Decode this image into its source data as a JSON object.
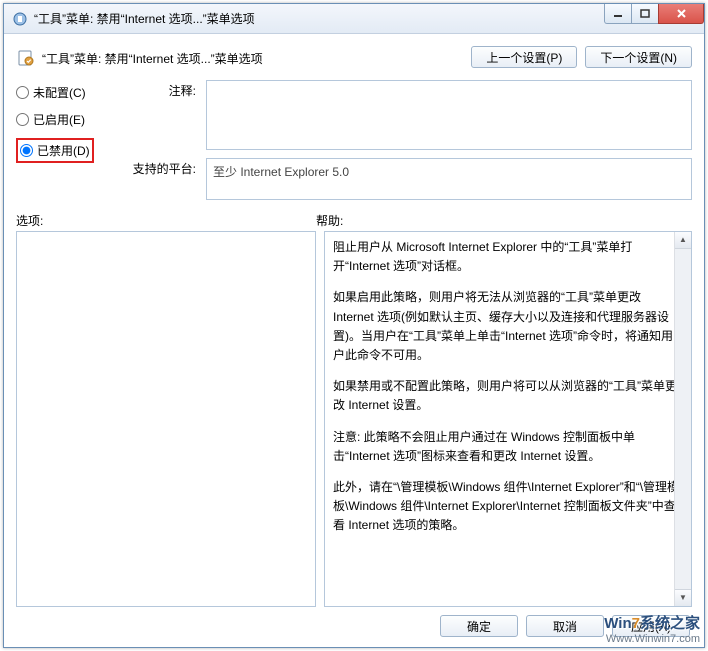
{
  "window": {
    "title": "“工具”菜单: 禁用“Internet 选项...”菜单选项"
  },
  "header": {
    "subtitle": "“工具”菜单: 禁用“Internet 选项...”菜单选项",
    "prev_btn": "上一个设置(P)",
    "next_btn": "下一个设置(N)"
  },
  "radios": {
    "not_configured": "未配置(C)",
    "enabled": "已启用(E)",
    "disabled": "已禁用(D)"
  },
  "fields": {
    "comment_label": "注释:",
    "platform_label": "支持的平台:",
    "platform_text": "至少 Internet Explorer 5.0"
  },
  "panels": {
    "options_label": "选项:",
    "help_label": "帮助:"
  },
  "help": {
    "p1": "阻止用户从 Microsoft Internet Explorer 中的“工具”菜单打开“Internet 选项”对话框。",
    "p2": "如果启用此策略，则用户将无法从浏览器的“工具”菜单更改 Internet 选项(例如默认主页、缓存大小以及连接和代理服务器设置)。当用户在“工具”菜单上单击“Internet 选项”命令时，将通知用户此命令不可用。",
    "p3": "如果禁用或不配置此策略，则用户将可以从浏览器的“工具”菜单更改 Internet 设置。",
    "p4": "注意: 此策略不会阻止用户通过在 Windows 控制面板中单击“Internet 选项”图标来查看和更改 Internet 设置。",
    "p5": "此外，请在“\\管理模板\\Windows 组件\\Internet Explorer”和“\\管理模板\\Windows 组件\\Internet Explorer\\Internet 控制面板文件夹”中查看 Internet 选项的策略。"
  },
  "footer": {
    "ok": "确定",
    "cancel": "取消",
    "apply": "应用(A)"
  },
  "watermark": {
    "line1a": "Win",
    "line1b": "7",
    "line1c": "系统之家",
    "line2": "Www.Winwin7.com"
  }
}
